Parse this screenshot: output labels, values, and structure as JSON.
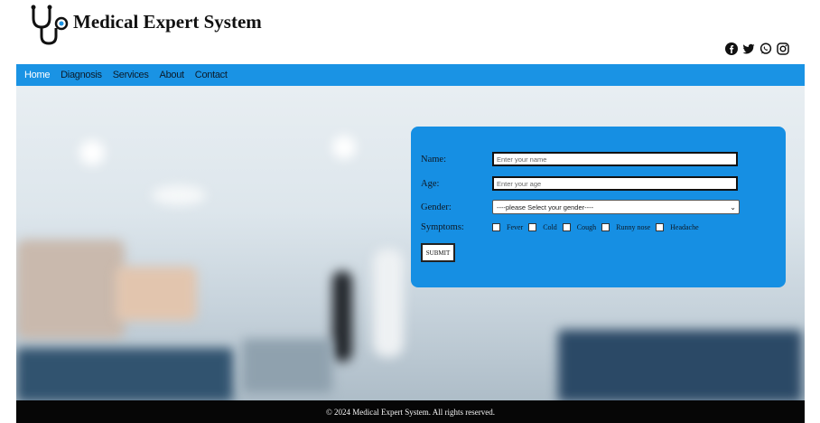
{
  "app": {
    "title": "Medical Expert System"
  },
  "social_icons": [
    "facebook-icon",
    "twitter-icon",
    "whatsapp-icon",
    "instagram-icon"
  ],
  "nav": {
    "items": [
      {
        "label": "Home",
        "active": true
      },
      {
        "label": "Diagnosis"
      },
      {
        "label": "Services"
      },
      {
        "label": "About"
      },
      {
        "label": "Contact"
      }
    ]
  },
  "form": {
    "name_label": "Name:",
    "name_placeholder": "Enter your name",
    "age_label": "Age:",
    "age_placeholder": "Enter your age",
    "gender_label": "Gender:",
    "gender_value": "----please Select your gender----",
    "symptoms_label": "Symptoms:",
    "symptoms": [
      "Fever",
      "Cold",
      "Cough",
      "Runny nose",
      "Headache"
    ],
    "submit_label": "SUBMIT"
  },
  "footer": {
    "text": "© 2024 Medical Expert System. All rights reserved."
  },
  "colors": {
    "nav": "#1a93e4",
    "panel": "#168fe3",
    "footer": "#060606"
  }
}
